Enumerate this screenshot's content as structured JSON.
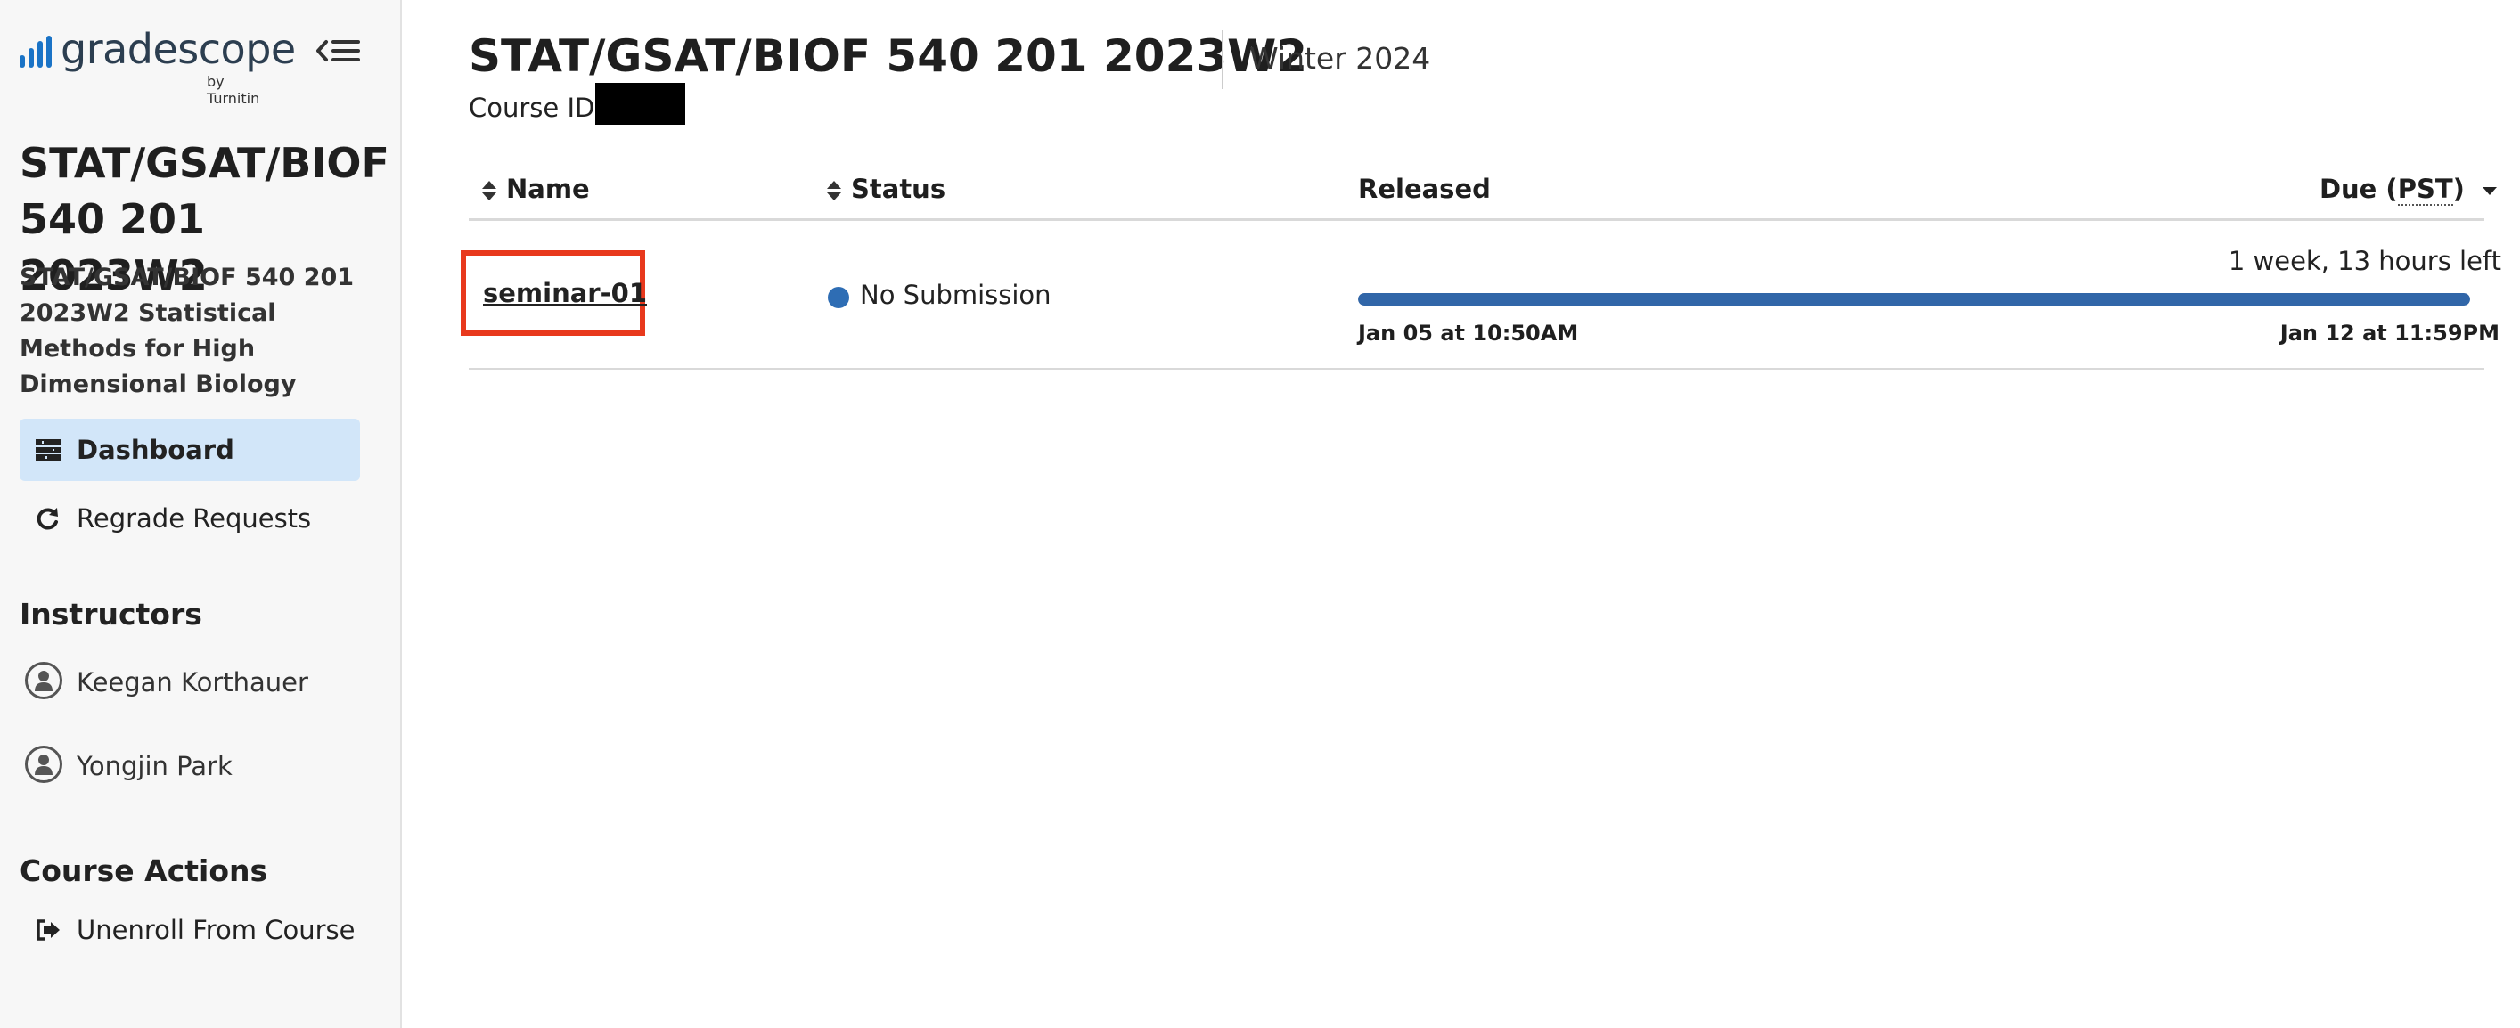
{
  "brand": {
    "name": "gradescope",
    "sub": "by Turnitin",
    "bar_color": "#1a73c6"
  },
  "sidebar": {
    "course_title": "STAT/GSAT/BIOF 540 201 2023W2",
    "course_subtitle": "STAT/GSAT/BIOF 540 201 2023W2 Statistical Methods for High Dimensional Biology",
    "nav": [
      {
        "label": "Dashboard",
        "icon": "dashboard-icon",
        "active": true
      },
      {
        "label": "Regrade Requests",
        "icon": "refresh-icon",
        "active": false
      }
    ],
    "instructors_heading": "Instructors",
    "instructors": [
      "Keegan Korthauer",
      "Yongjin Park"
    ],
    "actions_heading": "Course Actions",
    "actions": [
      {
        "label": "Unenroll From Course",
        "icon": "sign-out-icon"
      }
    ]
  },
  "header": {
    "title": "STAT/GSAT/BIOF 540 201 2023W2",
    "term": "Winter 2024",
    "course_id_label": "Course ID:"
  },
  "table": {
    "columns": {
      "name": "Name",
      "status": "Status",
      "released": "Released",
      "due_prefix": "Due (",
      "due_tz": "PST",
      "due_suffix": ")"
    },
    "rows": [
      {
        "name": "seminar-01",
        "status": "No Submission",
        "status_color": "#2e6db4",
        "time_left": "1 week, 13 hours left",
        "released": "Jan 05 at 10:50AM",
        "due": "Jan 12 at 11:59PM",
        "progress": 1.0,
        "progress_color": "#3166a8"
      }
    ]
  },
  "annotation": {
    "highlight_color": "#e8391d"
  }
}
